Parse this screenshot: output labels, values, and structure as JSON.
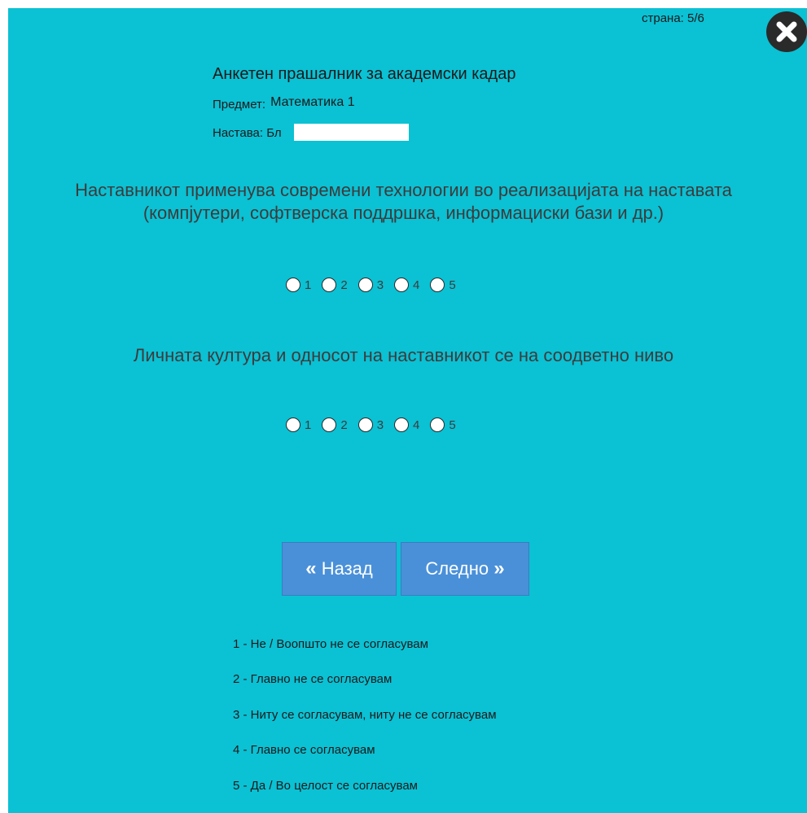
{
  "page_indicator": "страна: 5/6",
  "close": {
    "icon": "close-icon"
  },
  "survey": {
    "title": "Анкетен прашалник за академски кадар",
    "subject_label": "Предмет:",
    "subject_value": "Математика 1",
    "teacher_label": "Настава: Бл"
  },
  "questions": [
    {
      "line1": "Наставникот применува современи технологии во реализацијата на наставата",
      "line2": "(компјутери, софтверска поддршка, информациски бази и др.)",
      "options": [
        "1",
        "2",
        "3",
        "4",
        "5"
      ]
    },
    {
      "line1": "Личната култура и односот на наставникот се на соодветно ниво",
      "options": [
        "1",
        "2",
        "3",
        "4",
        "5"
      ]
    }
  ],
  "nav": {
    "back_glyph": "«",
    "back_label": "Назад",
    "next_label": "Следно",
    "next_glyph": "»"
  },
  "legend": [
    "1 - Не / Воопшто не се согласувам",
    "2 - Главно не се согласувам",
    "3 - Ниту се согласувам, ниту не се согласувам",
    "4 - Главно се согласувам",
    "5 - Да / Во целост се согласувам"
  ],
  "colors": {
    "panel": "#0bc1d4",
    "button": "#4a90d9",
    "close": "#2a2a2a"
  }
}
